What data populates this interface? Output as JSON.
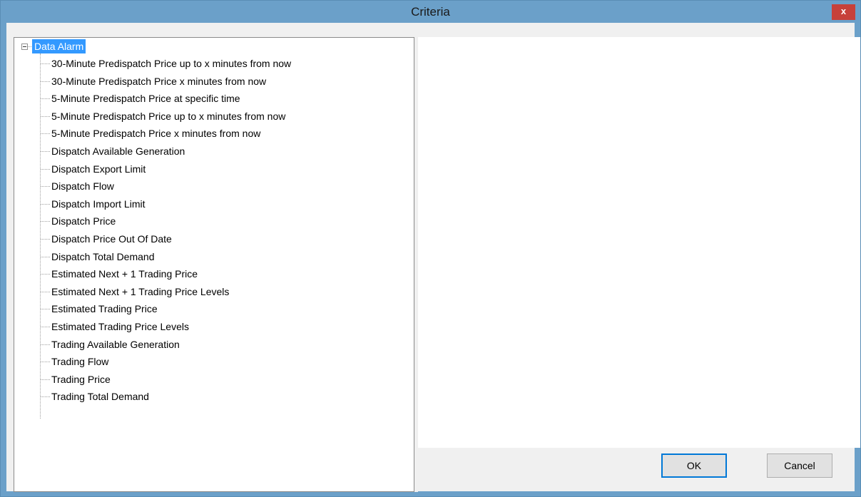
{
  "window": {
    "title": "Criteria",
    "close_label": "x"
  },
  "tree": {
    "root": {
      "label": "Data Alarm",
      "expanded": true,
      "selected": true
    },
    "children": [
      "30-Minute Predispatch Price up to x minutes from now",
      "30-Minute Predispatch Price x minutes from now",
      "5-Minute Predispatch Price at specific time",
      "5-Minute Predispatch Price up to x minutes from now",
      "5-Minute Predispatch Price x minutes from now",
      "Dispatch Available Generation",
      "Dispatch Export Limit",
      "Dispatch Flow",
      "Dispatch Import Limit",
      "Dispatch Price",
      "Dispatch Price Out Of Date",
      "Dispatch Total Demand",
      "Estimated Next + 1 Trading Price",
      "Estimated Next + 1 Trading Price Levels",
      "Estimated Trading Price",
      "Estimated Trading Price Levels",
      "Trading Available Generation",
      "Trading Flow",
      "Trading Price",
      "Trading Total Demand"
    ]
  },
  "buttons": {
    "ok_label": "OK",
    "cancel_label": "Cancel"
  },
  "colors": {
    "titlebar": "#6ba0c9",
    "close_button": "#c7413a",
    "selection": "#3399ff",
    "ok_border": "#0078d7"
  }
}
